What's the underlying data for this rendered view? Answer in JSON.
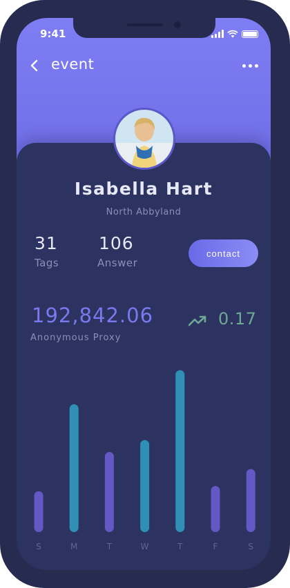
{
  "status_bar": {
    "time": "9:41"
  },
  "nav": {
    "back_icon": "chevron-left-icon",
    "title": "event",
    "more_icon": "more-horizontal-icon"
  },
  "profile": {
    "name": "Isabella Hart",
    "location": "North Abbyland"
  },
  "stats": [
    {
      "value": "31",
      "label": "Tags"
    },
    {
      "value": "106",
      "label": "Answer"
    }
  ],
  "contact_label": "contact",
  "balance": {
    "amount": "192,842.06",
    "label": "Anonymous Proxy",
    "trend_icon": "trending-up-icon",
    "trend_value": "0.17",
    "trend_color": "#6fa895"
  },
  "colors": {
    "accent": "#7e7df3",
    "bar_teal": "#2f8fb5",
    "bar_purple": "#6358c4"
  },
  "chart_data": {
    "type": "bar",
    "categories": [
      "S",
      "M",
      "T",
      "W",
      "T",
      "F",
      "S"
    ],
    "values": [
      24,
      75,
      47,
      54,
      95,
      27,
      37
    ],
    "ylim": [
      0,
      100
    ],
    "bar_colors": [
      "#6358c4",
      "#2f8fb5",
      "#6358c4",
      "#2f8fb5",
      "#2f8fb5",
      "#6358c4",
      "#6358c4"
    ]
  }
}
